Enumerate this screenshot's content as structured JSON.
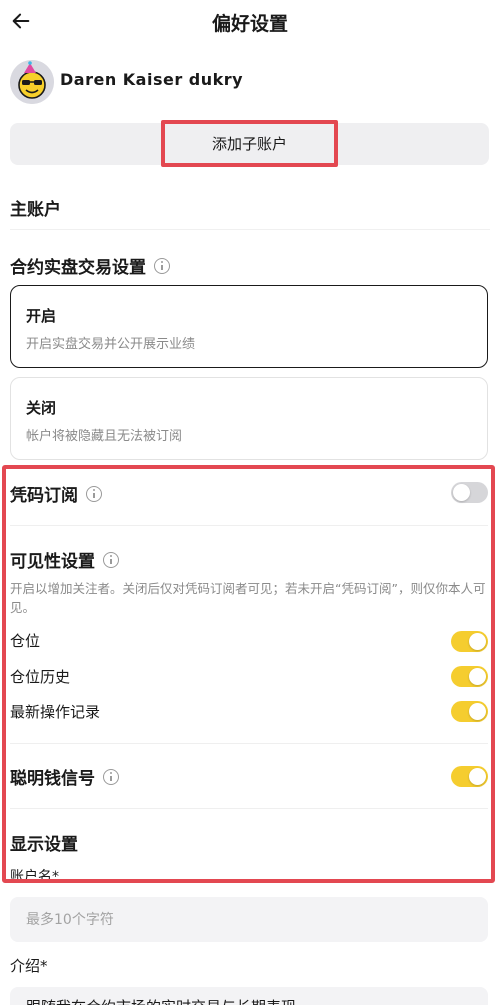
{
  "header": {
    "title": "偏好设置"
  },
  "profile": {
    "username": "Daren Kaiser dukry"
  },
  "add_sub_account": {
    "label": "添加子账户"
  },
  "main_account": {
    "title": "主账户"
  },
  "contract_trading": {
    "title": "合约实盘交易设置",
    "options": [
      {
        "title": "开启",
        "desc": "开启实盘交易并公开展示业绩",
        "selected": true
      },
      {
        "title": "关闭",
        "desc": "帐户将被隐藏且无法被订阅",
        "selected": false
      }
    ]
  },
  "copy_subscription": {
    "title": "凭码订阅",
    "enabled": false
  },
  "visibility": {
    "title": "可见性设置",
    "hint": "开启以增加关注者。关闭后仅对凭码订阅者可见；若未开启“凭码订阅”，则仅你本人可见。",
    "items": [
      {
        "label": "仓位",
        "enabled": true
      },
      {
        "label": "仓位历史",
        "enabled": true
      },
      {
        "label": "最新操作记录",
        "enabled": true
      }
    ]
  },
  "smart_money": {
    "title": "聪明钱信号",
    "enabled": true
  },
  "display_settings": {
    "title": "显示设置",
    "account_name_label": "账户名*",
    "account_name_placeholder": "最多10个字符",
    "intro_label": "介绍*",
    "intro_value": "跟随我在合约市场的实时交易与长期表现"
  },
  "colors": {
    "accent_yellow": "#f5cd2f",
    "highlight_red": "#e34851"
  }
}
